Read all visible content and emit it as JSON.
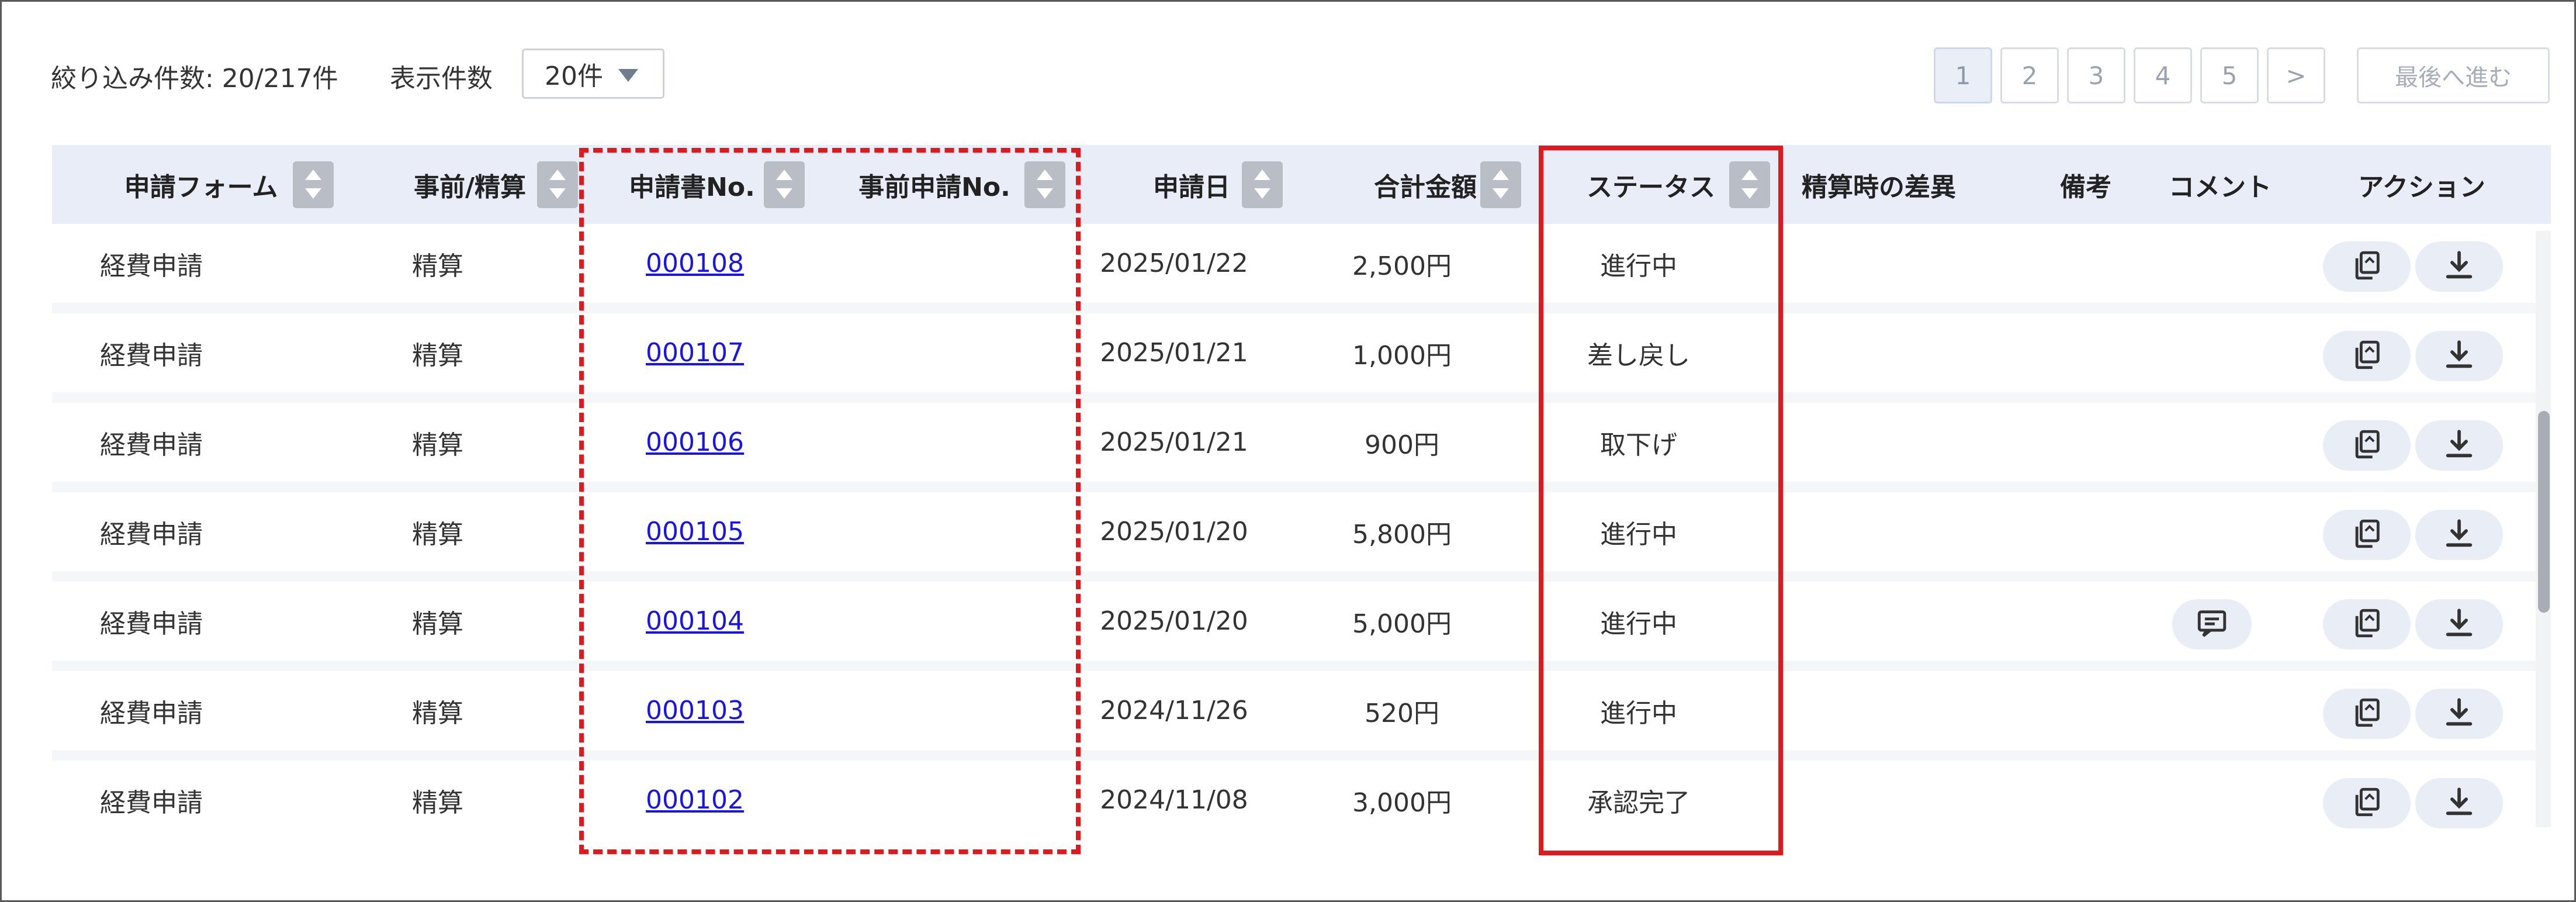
{
  "toolbar": {
    "filter_count": "絞り込み件数: 20/217件",
    "page_size_label": "表示件数",
    "page_size_value": "20件"
  },
  "pagination": {
    "pages": [
      "1",
      "2",
      "3",
      "4",
      "5",
      ">"
    ],
    "active_page": "1",
    "last_label": "最後へ進む"
  },
  "columns": [
    {
      "label": "申請フォーム",
      "sortable": true
    },
    {
      "label": "事前/精算",
      "sortable": true
    },
    {
      "label": "申請書No.",
      "sortable": true
    },
    {
      "label": "事前申請No.",
      "sortable": true
    },
    {
      "label": "申請日",
      "sortable": true
    },
    {
      "label": "合計金額",
      "sortable": true
    },
    {
      "label": "ステータス",
      "sortable": true
    },
    {
      "label": "精算時の差異",
      "sortable": false
    },
    {
      "label": "備考",
      "sortable": false
    },
    {
      "label": "コメント",
      "sortable": false
    },
    {
      "label": "アクション",
      "sortable": false
    }
  ],
  "rows": [
    {
      "form": "経費申請",
      "type": "精算",
      "app_no": "000108",
      "pre_no": "",
      "date": "2025/01/22",
      "amount": "2,500円",
      "status": "進行中",
      "diff": "",
      "note": "",
      "has_comment": false
    },
    {
      "form": "経費申請",
      "type": "精算",
      "app_no": "000107",
      "pre_no": "",
      "date": "2025/01/21",
      "amount": "1,000円",
      "status": "差し戻し",
      "diff": "",
      "note": "",
      "has_comment": false
    },
    {
      "form": "経費申請",
      "type": "精算",
      "app_no": "000106",
      "pre_no": "",
      "date": "2025/01/21",
      "amount": "900円",
      "status": "取下げ",
      "diff": "",
      "note": "",
      "has_comment": false
    },
    {
      "form": "経費申請",
      "type": "精算",
      "app_no": "000105",
      "pre_no": "",
      "date": "2025/01/20",
      "amount": "5,800円",
      "status": "進行中",
      "diff": "",
      "note": "",
      "has_comment": false
    },
    {
      "form": "経費申請",
      "type": "精算",
      "app_no": "000104",
      "pre_no": "",
      "date": "2025/01/20",
      "amount": "5,000円",
      "status": "進行中",
      "diff": "",
      "note": "",
      "has_comment": true
    },
    {
      "form": "経費申請",
      "type": "精算",
      "app_no": "000103",
      "pre_no": "",
      "date": "2024/11/26",
      "amount": "520円",
      "status": "進行中",
      "diff": "",
      "note": "",
      "has_comment": false
    },
    {
      "form": "経費申請",
      "type": "精算",
      "app_no": "000102",
      "pre_no": "",
      "date": "2024/11/08",
      "amount": "3,000円",
      "status": "承認完了",
      "diff": "",
      "note": "",
      "has_comment": false
    }
  ],
  "icons": {
    "copy": "copy-icon",
    "download": "download-icon",
    "comment": "comment-icon",
    "sort": "sort-icon",
    "dropdown": "chevron-down-icon"
  },
  "colors": {
    "header_bg": "#e9edf8",
    "link": "#1a14e6",
    "highlight": "#e0191e",
    "action_pill": "#e8edf6"
  }
}
